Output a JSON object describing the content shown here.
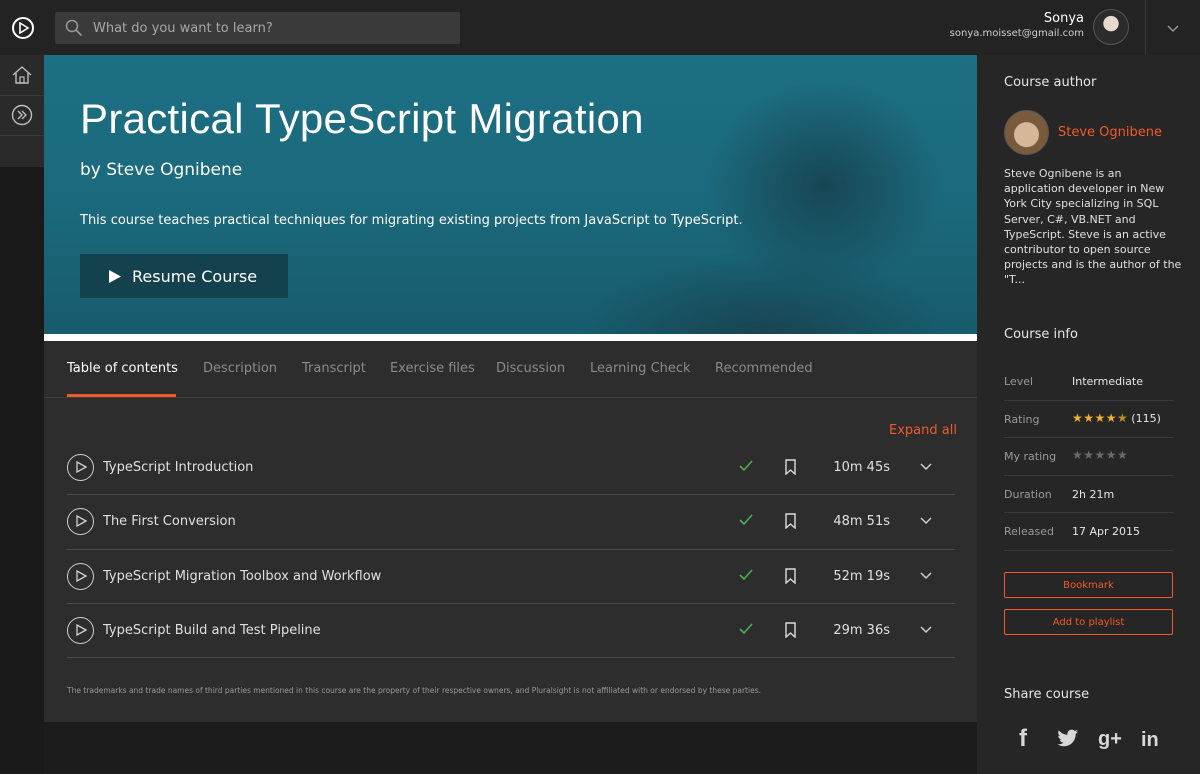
{
  "search": {
    "placeholder": "What do you want to learn?"
  },
  "user": {
    "name": "Sonya",
    "email": "sonya.moisset@gmail.com"
  },
  "hero": {
    "title": "Practical TypeScript Migration",
    "byline": "by Steve Ognibene",
    "description": "This course teaches practical techniques for migrating existing projects from JavaScript to TypeScript.",
    "resume_label": "Resume Course"
  },
  "tabs": [
    {
      "label": "Table of contents"
    },
    {
      "label": "Description"
    },
    {
      "label": "Transcript"
    },
    {
      "label": "Exercise files"
    },
    {
      "label": "Discussion"
    },
    {
      "label": "Learning Check"
    },
    {
      "label": "Recommended"
    }
  ],
  "toc": {
    "expand_all": "Expand all",
    "modules": [
      {
        "title": "TypeScript Introduction",
        "duration": "10m 45s"
      },
      {
        "title": "The First Conversion",
        "duration": "48m 51s"
      },
      {
        "title": "TypeScript Migration Toolbox and Workflow",
        "duration": "52m 19s"
      },
      {
        "title": "TypeScript Build and Test Pipeline",
        "duration": "29m 36s"
      }
    ],
    "disclaimer": "The trademarks and trade names of third parties mentioned in this course are the property of their respective owners, and Pluralsight is not affiliated with or endorsed by these parties."
  },
  "sidebar": {
    "author_heading": "Course author",
    "author_name": "Steve Ognibene",
    "author_bio": "Steve Ognibene is an application developer in New York City specializing in SQL Server, C#, VB.NET and TypeScript. Steve is an active contributor to open source projects and is the author of the \"T...",
    "info_heading": "Course info",
    "info": {
      "level_label": "Level",
      "level": "Intermediate",
      "rating_label": "Rating",
      "rating": 4.5,
      "rating_count": "(115)",
      "my_rating_label": "My rating",
      "my_rating": 0,
      "duration_label": "Duration",
      "duration": "2h 21m",
      "released_label": "Released",
      "released": "17 Apr 2015"
    },
    "bookmark_label": "Bookmark",
    "playlist_label": "Add to playlist",
    "share_heading": "Share course",
    "social": {
      "facebook": "f",
      "googleplus": "g+",
      "linkedin": "in"
    }
  },
  "colors": {
    "accent": "#f05a28",
    "hero": "#1b6a7d",
    "check": "#4caf50",
    "star": "#f0b030"
  }
}
